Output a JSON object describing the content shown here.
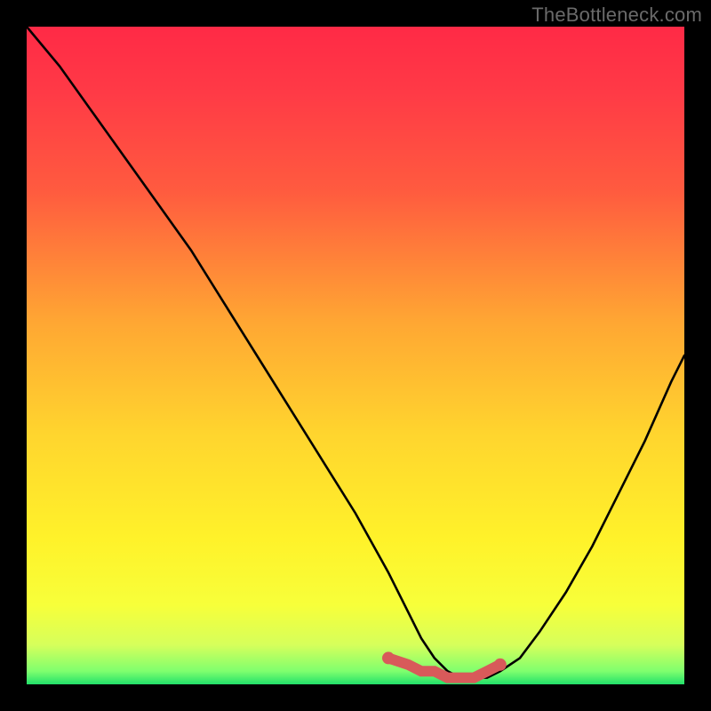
{
  "watermark": "TheBottleneck.com",
  "chart_data": {
    "type": "line",
    "title": "",
    "xlabel": "",
    "ylabel": "",
    "xlim": [
      0,
      100
    ],
    "ylim": [
      0,
      100
    ],
    "series": [
      {
        "name": "bottleneck-curve",
        "x": [
          0,
          5,
          10,
          15,
          20,
          25,
          30,
          35,
          40,
          45,
          50,
          55,
          58,
          60,
          62,
          64,
          66,
          68,
          70,
          72,
          75,
          78,
          82,
          86,
          90,
          94,
          98,
          100
        ],
        "values": [
          100,
          94,
          87,
          80,
          73,
          66,
          58,
          50,
          42,
          34,
          26,
          17,
          11,
          7,
          4,
          2,
          1,
          1,
          1,
          2,
          4,
          8,
          14,
          21,
          29,
          37,
          46,
          50
        ]
      }
    ],
    "markers": {
      "name": "highlight-band",
      "x": [
        55,
        58,
        60,
        62,
        64,
        66,
        68,
        70,
        72
      ],
      "values": [
        4,
        3,
        2,
        2,
        1,
        1,
        1,
        2,
        3
      ],
      "color": "#d85a5a"
    },
    "gradient_stops": [
      {
        "pos": 0,
        "color": "#ff2a46"
      },
      {
        "pos": 25,
        "color": "#ff5b3f"
      },
      {
        "pos": 50,
        "color": "#ffc52e"
      },
      {
        "pos": 78,
        "color": "#fff22a"
      },
      {
        "pos": 98,
        "color": "#7fff6e"
      },
      {
        "pos": 100,
        "color": "#22e06a"
      }
    ]
  }
}
